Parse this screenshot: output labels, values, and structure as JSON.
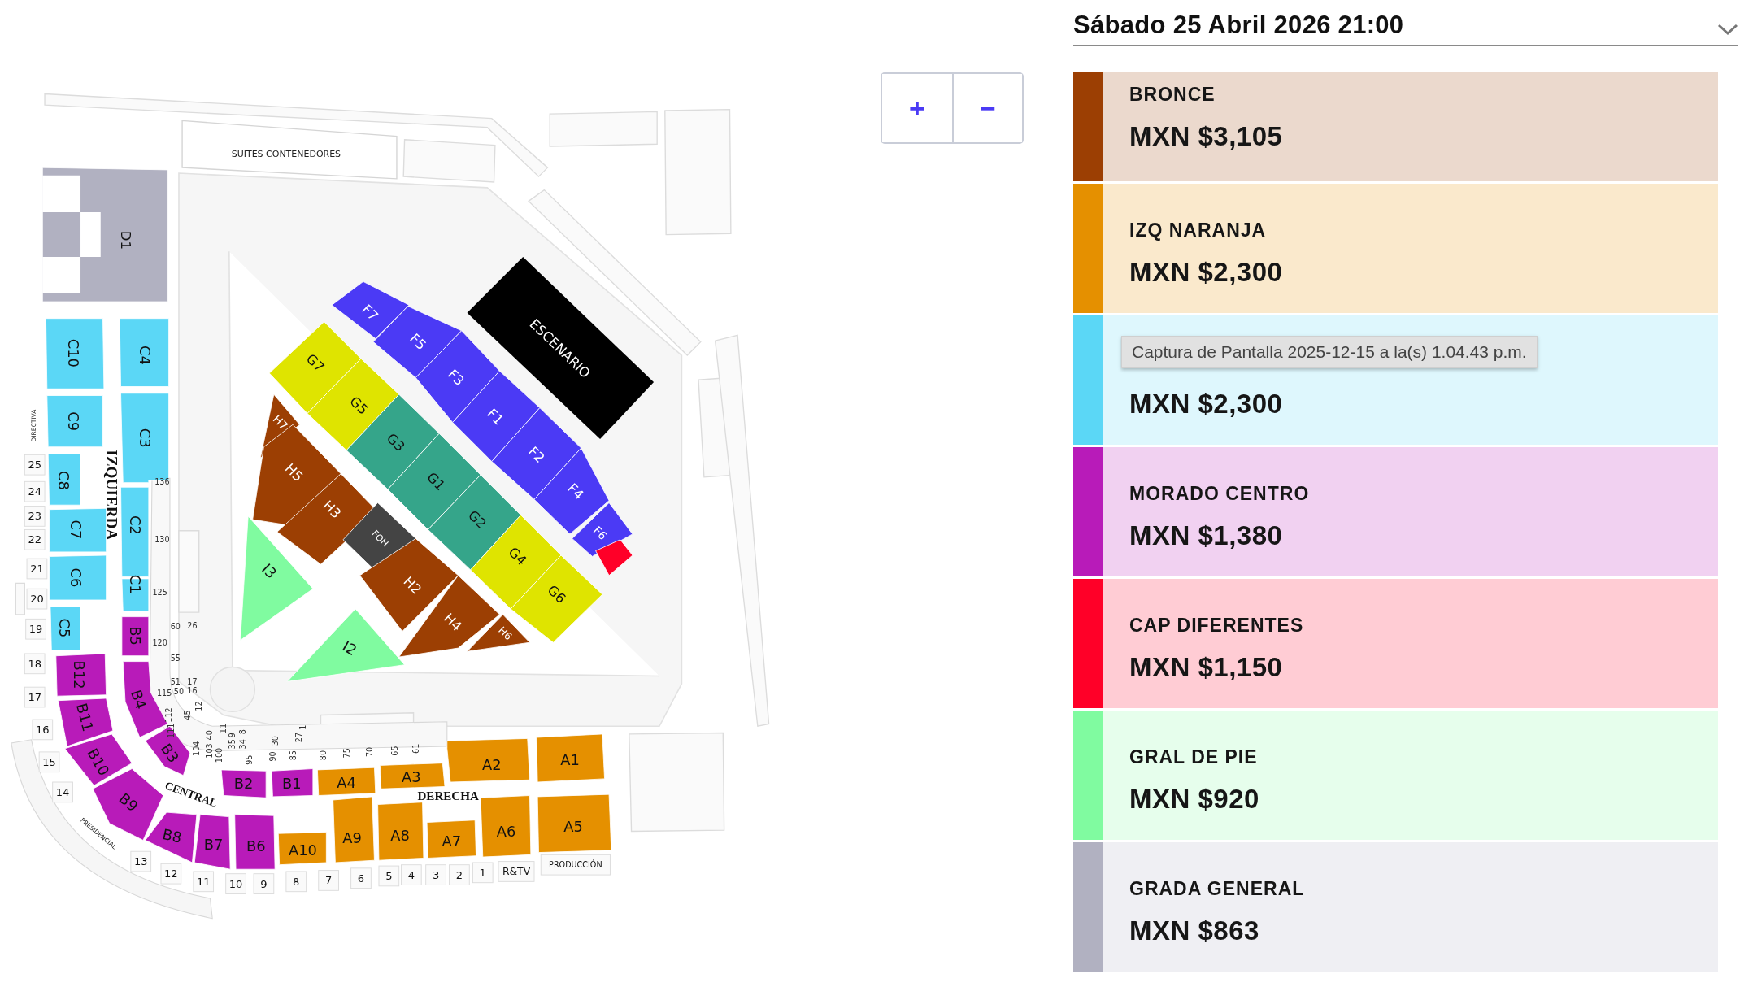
{
  "date_selector": {
    "value": "Sábado 25 Abril 2026 21:00"
  },
  "zoom_controls": [
    "+",
    "−"
  ],
  "map": {
    "stage": {
      "label": "ESCENARIO"
    },
    "sections": [
      {
        "label": "D1",
        "color": "#b1b1c1"
      },
      {
        "label": "C10",
        "color": "#5bd7f6"
      },
      {
        "label": "C4",
        "color": "#5bd7f6"
      },
      {
        "label": "C9",
        "color": "#5bd7f6"
      },
      {
        "label": "C3",
        "color": "#5bd7f6"
      },
      {
        "label": "C8",
        "color": "#5bd7f6"
      },
      {
        "label": "C2",
        "color": "#5bd7f6"
      },
      {
        "label": "C7",
        "color": "#5bd7f6"
      },
      {
        "label": "C1",
        "color": "#5bd7f6"
      },
      {
        "label": "C6",
        "color": "#5bd7f6"
      },
      {
        "label": "C5",
        "color": "#5bd7f6"
      },
      {
        "label": "B5",
        "color": "#b81bb9"
      },
      {
        "label": "B12",
        "color": "#b81bb9"
      },
      {
        "label": "B4",
        "color": "#b81bb9"
      },
      {
        "label": "B11",
        "color": "#b81bb9"
      },
      {
        "label": "B3",
        "color": "#b81bb9"
      },
      {
        "label": "B10",
        "color": "#b81bb9"
      },
      {
        "label": "B2",
        "color": "#b81bb9"
      },
      {
        "label": "B1",
        "color": "#b81bb9"
      },
      {
        "label": "A4",
        "color": "#e59000"
      },
      {
        "label": "A3",
        "color": "#e59000"
      },
      {
        "label": "A2",
        "color": "#e59000"
      },
      {
        "label": "A1",
        "color": "#e59000"
      },
      {
        "label": "B9",
        "color": "#b81bb9"
      },
      {
        "label": "B8",
        "color": "#b81bb9"
      },
      {
        "label": "B7",
        "color": "#b81bb9"
      },
      {
        "label": "B6",
        "color": "#b81bb9"
      },
      {
        "label": "A10",
        "color": "#e59000"
      },
      {
        "label": "A9",
        "color": "#e59000"
      },
      {
        "label": "A8",
        "color": "#e59000"
      },
      {
        "label": "A7",
        "color": "#e59000"
      },
      {
        "label": "A6",
        "color": "#e59000"
      },
      {
        "label": "A5",
        "color": "#e59000"
      },
      {
        "label": "F7",
        "color": "#4b3af5"
      },
      {
        "label": "F5",
        "color": "#4b3af5"
      },
      {
        "label": "F3",
        "color": "#4b3af5"
      },
      {
        "label": "F1",
        "color": "#4b3af5"
      },
      {
        "label": "F2",
        "color": "#4b3af5"
      },
      {
        "label": "F4",
        "color": "#4b3af5"
      },
      {
        "label": "F6",
        "color": "#4b3af5"
      },
      {
        "color": "#ff0028"
      },
      {
        "label": "G7",
        "color": "#dfe400"
      },
      {
        "label": "G5",
        "color": "#dfe400"
      },
      {
        "label": "G3",
        "color": "#35a58a"
      },
      {
        "label": "G1",
        "color": "#35a58a"
      },
      {
        "label": "G2",
        "color": "#35a58a"
      },
      {
        "label": "G4",
        "color": "#dfe400"
      },
      {
        "label": "G6",
        "color": "#dfe400"
      },
      {
        "label": "H7",
        "color": "#9c3f03"
      },
      {
        "label": "H5",
        "color": "#9c3f03"
      },
      {
        "label": "H3",
        "color": "#9c3f03"
      },
      {
        "label": "FOH",
        "color": "#444444"
      },
      {
        "label": "H2",
        "color": "#9c3f03"
      },
      {
        "label": "H4",
        "color": "#9c3f03"
      },
      {
        "label": "H6",
        "color": "#9c3f03"
      },
      {
        "label": "I3",
        "color": "#80fba0"
      },
      {
        "label": "I2",
        "color": "#80fba0"
      }
    ],
    "area_labels": [
      {
        "text": "SUITES CONTENEDORES",
        "kind": "plain"
      },
      {
        "text": "IZQUIERDA",
        "kind": "zone"
      },
      {
        "text": "CENTRAL",
        "kind": "zone"
      },
      {
        "text": "DERECHA",
        "kind": "zone"
      },
      {
        "text": "DIRECTIVA",
        "kind": "plain"
      },
      {
        "text": "PRESIDENCIAL",
        "kind": "plain"
      }
    ],
    "row_numbers": [
      "25",
      "24",
      "23",
      "22",
      "21",
      "20",
      "19",
      "18",
      "17",
      "16",
      "15",
      "14",
      "13",
      "12",
      "11",
      "10",
      "9",
      "8",
      "7",
      "6",
      "5",
      "4",
      "3",
      "2",
      "1",
      "R&TV",
      "PRODUCCIÓN"
    ],
    "seat_numbers": [
      "136",
      "130",
      "125",
      "120",
      "60",
      "26",
      "55",
      "51",
      "17",
      "115",
      "50",
      "16",
      "112",
      "45",
      "12",
      "111",
      "40",
      "11",
      "9",
      "8",
      "1",
      "104",
      "103",
      "100",
      "35",
      "34",
      "30",
      "27",
      "95",
      "90",
      "85",
      "80",
      "75",
      "70",
      "65",
      "61"
    ]
  },
  "price_tiers": [
    {
      "name": "BRONCE",
      "price": "MXN $3,105",
      "color": "#9c3f03"
    },
    {
      "name": "IZQ NARANJA",
      "price": "MXN $2,300",
      "color": "#e59000"
    },
    {
      "price": "MXN $2,300",
      "color": "#5bd7f6"
    },
    {
      "name": "MORADO CENTRO",
      "price": "MXN $1,380",
      "color": "#b81bb9"
    },
    {
      "name": "CAP DIFERENTES",
      "price": "MXN $1,150",
      "color": "#ff0028"
    },
    {
      "name": "GRAL DE PIE",
      "price": "MXN $920",
      "color": "#80fba0"
    },
    {
      "name": "GRADA GENERAL",
      "price": "MXN $863",
      "color": "#b1b1c1"
    }
  ],
  "tooltip": {
    "text": "Captura de Pantalla 2025-12-15 a la(s) 1.04.43 p.m."
  }
}
